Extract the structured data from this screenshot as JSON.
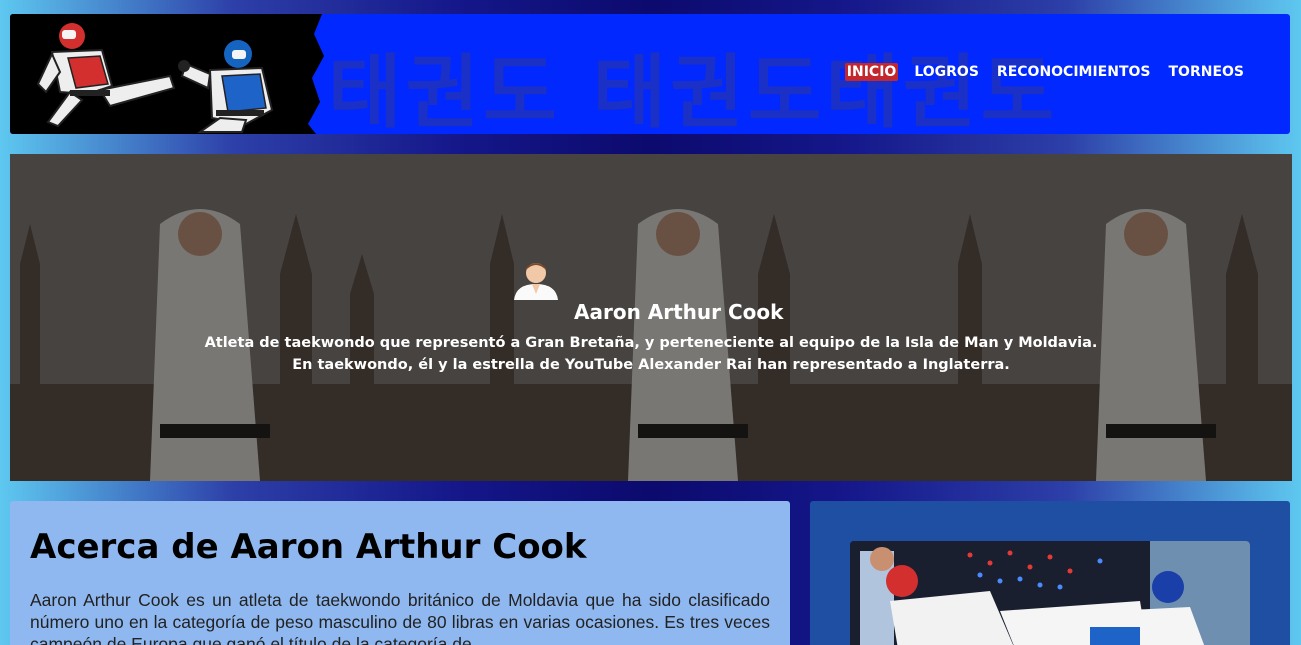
{
  "header": {
    "korean_watermark": "태권도 태권도태권도",
    "logo_alt": "taekwondo-fighters-logo"
  },
  "nav": {
    "items": [
      {
        "label": "INICIO",
        "active": true
      },
      {
        "label": "LOGROS",
        "active": false
      },
      {
        "label": "RECONOCIMIENTOS",
        "active": false
      },
      {
        "label": "TORNEOS",
        "active": false
      }
    ]
  },
  "hero": {
    "name": "Aaron Arthur Cook",
    "line1": "Atleta de taekwondo que representó a Gran Bretaña, y perteneciente al equipo de la Isla de Man y Moldavia.",
    "line2": "En taekwondo, él y la estrella de YouTube Alexander Rai han representado a Inglaterra."
  },
  "about": {
    "title": "Acerca de Aaron Arthur Cook",
    "body": "Aaron Arthur Cook es un atleta de taekwondo británico de Moldavia que ha sido clasificado número uno en la categoría de peso masculino de 80 libras en varias ocasiones. Es tres veces campeón de Europa que ganó el título de la categoría de"
  },
  "colors": {
    "header_bg": "#0028ff",
    "nav_active": "#c1272d",
    "about_bg": "#8fb8f0",
    "side_bg": "#1e4fa3"
  }
}
